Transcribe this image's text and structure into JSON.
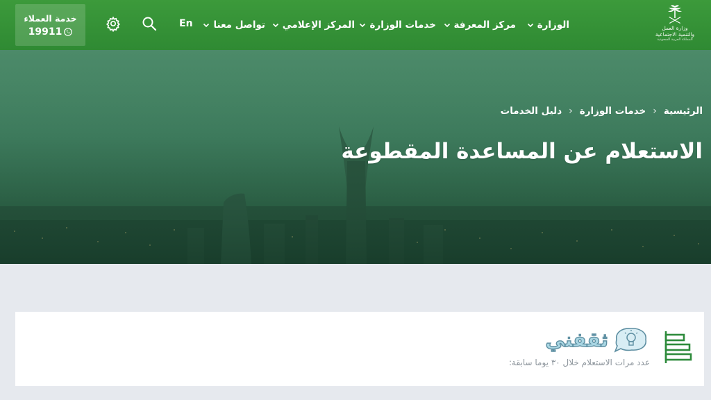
{
  "header": {
    "logo": {
      "line1": "وزارة العمل",
      "line2": "والتنمية الاجتماعية",
      "line3": "المملكة العربية السعودية",
      "icon": "palm-swords-icon"
    },
    "nav": [
      {
        "label": "الوزارة",
        "has_dropdown": true
      },
      {
        "label": "مركز المعرفة",
        "has_dropdown": true
      },
      {
        "label": "خدمات الوزارة",
        "has_dropdown": true
      },
      {
        "label": "المركز الإعلامي",
        "has_dropdown": true
      },
      {
        "label": "تواصل معنا",
        "has_dropdown": true
      }
    ],
    "language_toggle": "En",
    "search_icon": "search-icon",
    "settings_icon": "gear-icon",
    "hotline": {
      "label": "خدمة العملاء",
      "number": "19911",
      "icon": "phone-icon"
    }
  },
  "hero": {
    "breadcrumb": [
      "الرئيسية",
      "خدمات الوزارة",
      "دليل الخدمات"
    ],
    "title": "الاستعلام عن المساعدة المقطوعة"
  },
  "card": {
    "icon": "service-list-icon",
    "brand": {
      "text": "ثقفني",
      "icon": "lightbulb-bubble-icon"
    },
    "description": "عدد مرات الاستعلام خلال ٣٠ يوما سابقة:"
  },
  "colors": {
    "header_green": "#2f8a33",
    "card_icon_green": "#2e8b3c",
    "brand_blue": "#a9d6e3",
    "page_bg": "#e6e9ee"
  }
}
